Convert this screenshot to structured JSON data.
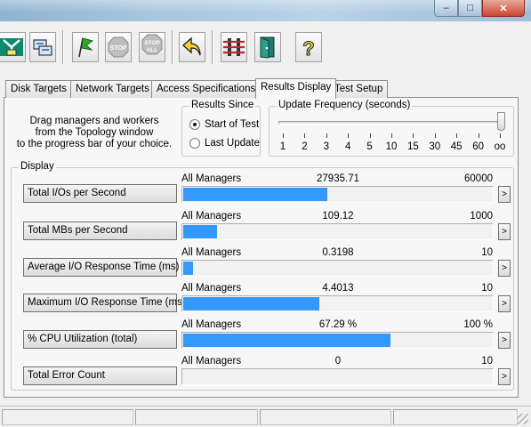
{
  "window": {
    "min_glyph": "–",
    "max_glyph": "□",
    "close_glyph": "✕"
  },
  "toolbar": {
    "icons": [
      "topology-icon",
      "network-icon",
      "start-flag-icon",
      "stop-icon",
      "stop-all-icon",
      "back-arrow-icon",
      "workers-icon",
      "exit-icon",
      "help-icon"
    ],
    "stop_label": "STOP",
    "stop_all_label_1": "STOP",
    "stop_all_label_2": "ALL",
    "help_glyph": "?"
  },
  "tabs": [
    {
      "label": "Disk Targets"
    },
    {
      "label": "Network Targets"
    },
    {
      "label": "Access Specifications"
    },
    {
      "label": "Results Display",
      "active": true
    },
    {
      "label": "Test Setup"
    }
  ],
  "instructions": {
    "line1": "Drag managers and workers",
    "line2": "from the Topology window",
    "line3": "to the progress bar of your choice."
  },
  "results_since": {
    "title": "Results Since",
    "options": [
      {
        "label": "Start of Test",
        "selected": true
      },
      {
        "label": "Last Update",
        "selected": false
      }
    ]
  },
  "update_frequency": {
    "title": "Update Frequency (seconds)",
    "ticks": [
      "1",
      "2",
      "3",
      "4",
      "5",
      "10",
      "15",
      "30",
      "45",
      "60",
      "oo"
    ],
    "selected": "oo"
  },
  "display": {
    "title": "Display",
    "metrics": [
      {
        "label": "Total I/Os per Second",
        "manager": "All Managers",
        "value": "27935.71",
        "max": "60000",
        "fill_pct": 46.6
      },
      {
        "label": "Total MBs per Second",
        "manager": "All Managers",
        "value": "109.12",
        "max": "1000",
        "fill_pct": 10.9
      },
      {
        "label": "Average I/O Response Time (ms)",
        "manager": "All Managers",
        "value": "0.3198",
        "max": "10",
        "fill_pct": 3.2
      },
      {
        "label": "Maximum I/O Response Time (ms)",
        "manager": "All Managers",
        "value": "4.4013",
        "max": "10",
        "fill_pct": 44.0
      },
      {
        "label": "% CPU Utilization (total)",
        "manager": "All Managers",
        "value": "67.29 %",
        "max": "100 %",
        "fill_pct": 67.29
      },
      {
        "label": "Total Error Count",
        "manager": "All Managers",
        "value": "0",
        "max": "10",
        "fill_pct": 0
      }
    ],
    "arrow_glyph": ">"
  },
  "colors": {
    "bar_fill": "#3399ff",
    "close_button": "#c8452f"
  }
}
